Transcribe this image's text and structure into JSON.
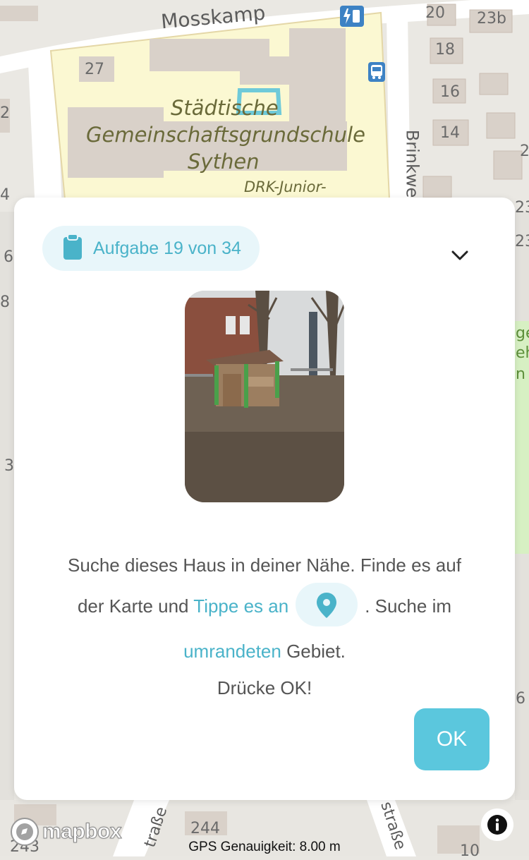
{
  "map": {
    "street_top": "Mosskamp",
    "street_right": "Brinkwe",
    "street_bottom_left": "traße",
    "street_bottom_right": "straße",
    "school_name_1": "Städtische",
    "school_name_2": "Gemeinschaftsgrundschule",
    "school_name_3": "Sythen",
    "poi_drk": "DRK-Junior-",
    "house_numbers": [
      "27",
      "20",
      "23b",
      "18",
      "16",
      "14",
      "244",
      "243",
      "10",
      "2",
      "4",
      "6",
      "8",
      "3",
      "2",
      "23",
      "23",
      "6",
      "ge",
      "eh",
      "n"
    ]
  },
  "card": {
    "task_label": "Aufgabe 19 von 34",
    "text_1": "Suche dieses Haus in deiner Nähe. Finde es auf",
    "text_2_pre": "der Karte und ",
    "text_2_link": "Tippe es an",
    "text_2_post": ". Suche im",
    "text_3_link": "umrandeten",
    "text_3_post": " Gebiet.",
    "press_ok": "Drücke OK!",
    "ok_label": "OK"
  },
  "footer": {
    "mapbox": "mapbox",
    "gps_text": "GPS Genauigkeit: 8.00 m"
  },
  "colors": {
    "accent": "#4ab3c9",
    "accent_bg": "#e8f6fa",
    "ok_button": "#5bc7dd",
    "school_area": "#fbf8d2"
  },
  "icons": {
    "clipboard": "clipboard-icon",
    "chevron": "chevron-down-icon",
    "pin": "map-pin-icon",
    "info": "info-icon",
    "charging": "ev-charging-icon",
    "bus": "bus-stop-icon"
  }
}
